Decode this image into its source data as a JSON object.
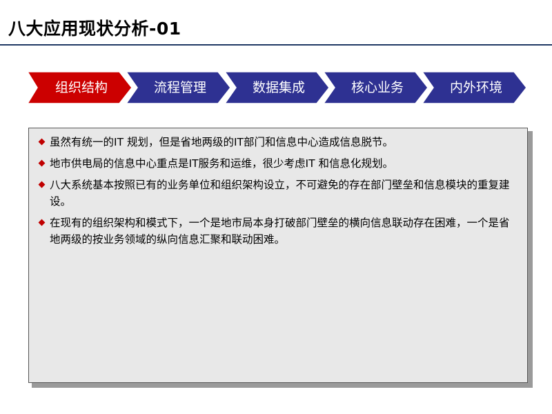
{
  "title": "八大应用现状分析-01",
  "nav": {
    "steps": [
      {
        "label": "组织结构",
        "active": true
      },
      {
        "label": "流程管理",
        "active": false
      },
      {
        "label": "数据集成",
        "active": false
      },
      {
        "label": "核心业务",
        "active": false
      },
      {
        "label": "内外环境",
        "active": false
      }
    ]
  },
  "colors": {
    "active_step": "#cc0000",
    "inactive_step": "#2e3192",
    "bullet": "#c00000",
    "title_rule": "#1f3864",
    "content_bg": "#e8e8e8"
  },
  "bullets": [
    "虽然有统一的IT 规划，但是省地两级的IT部门和信息中心造成信息脱节。",
    "地市供电局的信息中心重点是IT服务和运维，很少考虑IT 和信息化规划。",
    "八大系统基本按照已有的业务单位和组织架构设立，不可避免的存在部门壁垒和信息模块的重复建设。",
    "在现有的组织架构和模式下，一个是地市局本身打破部门壁垒的横向信息联动存在困难，一个是省地两级的按业务领域的纵向信息汇聚和联动困难。"
  ]
}
